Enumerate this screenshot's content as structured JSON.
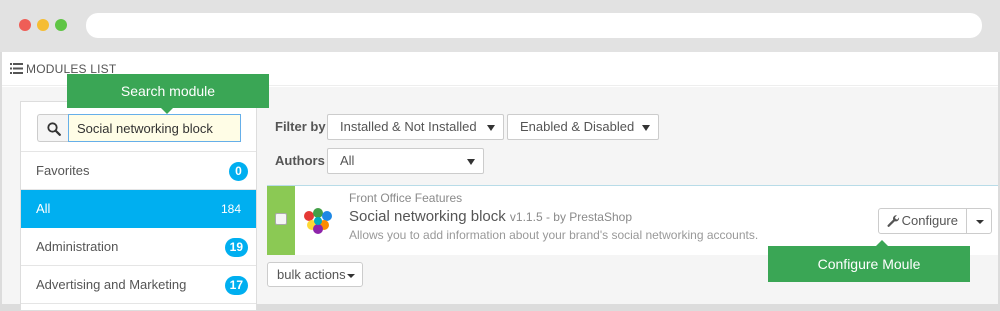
{
  "panel": {
    "title": "MODULES LIST"
  },
  "tooltips": {
    "search": "Search module",
    "configure": "Configure Moule"
  },
  "search": {
    "value": "Social networking block"
  },
  "categories": [
    {
      "label": "Favorites",
      "count": "0",
      "active": false
    },
    {
      "label": "All",
      "count": "184",
      "active": true
    },
    {
      "label": "Administration",
      "count": "19",
      "active": false
    },
    {
      "label": "Advertising and Marketing",
      "count": "17",
      "active": false
    }
  ],
  "filters": {
    "filter_by_label": "Filter by",
    "install_status": "Installed & Not Installed",
    "enabled_status": "Enabled & Disabled",
    "authors_label": "Authors",
    "authors_value": "All"
  },
  "module": {
    "category": "Front Office Features",
    "name": "Social networking block",
    "version": "v1.1.5 - by PrestaShop",
    "description": "Allows you to add information about your brand's social networking accounts.",
    "configure_label": "Configure"
  },
  "bulk": {
    "label": "bulk actions"
  },
  "colors": {
    "accent": "#00aff0",
    "enabled": "#8bc954",
    "tooltip": "#3aa655"
  }
}
